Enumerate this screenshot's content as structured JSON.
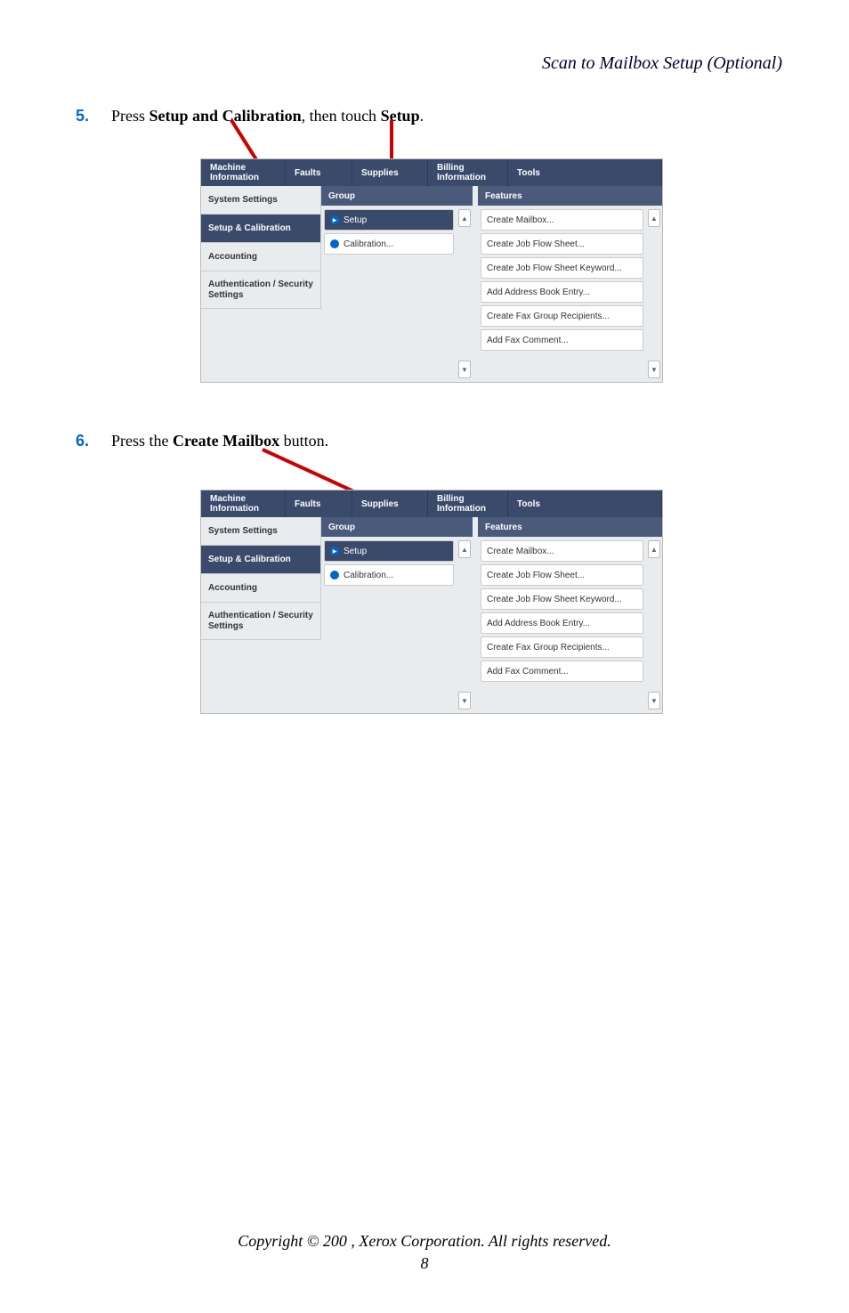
{
  "header": {
    "title": "Scan to Mailbox Setup (Optional)"
  },
  "steps": {
    "s5": {
      "num": "5.",
      "pre": "Press ",
      "b1": "Setup and Calibration",
      "mid": ", then touch ",
      "b2": "Setup",
      "post": "."
    },
    "s6": {
      "num": "6.",
      "pre": "Press the ",
      "b1": "Create Mailbox",
      "post": " button."
    }
  },
  "tabs": {
    "machine": "Machine Information",
    "faults": "Faults",
    "supplies": "Supplies",
    "billing": "Billing Information",
    "tools": "Tools"
  },
  "sidebar": {
    "system": "System Settings",
    "setup_calib": "Setup & Calibration",
    "accounting": "Accounting",
    "auth": "Authentication / Security Settings"
  },
  "cols": {
    "group": "Group",
    "features": "Features"
  },
  "group_items": {
    "setup": "Setup",
    "calibration": "Calibration..."
  },
  "feature_items": [
    "Create Mailbox...",
    "Create Job Flow Sheet...",
    "Create Job Flow Sheet Keyword...",
    "Add Address Book Entry...",
    "Create Fax Group Recipients...",
    "Add Fax Comment..."
  ],
  "scroll": {
    "up": "▲",
    "down": "▼"
  },
  "footer": {
    "copyright": "Copyright © 200 , Xerox Corporation. All rights reserved.",
    "page": "8"
  }
}
